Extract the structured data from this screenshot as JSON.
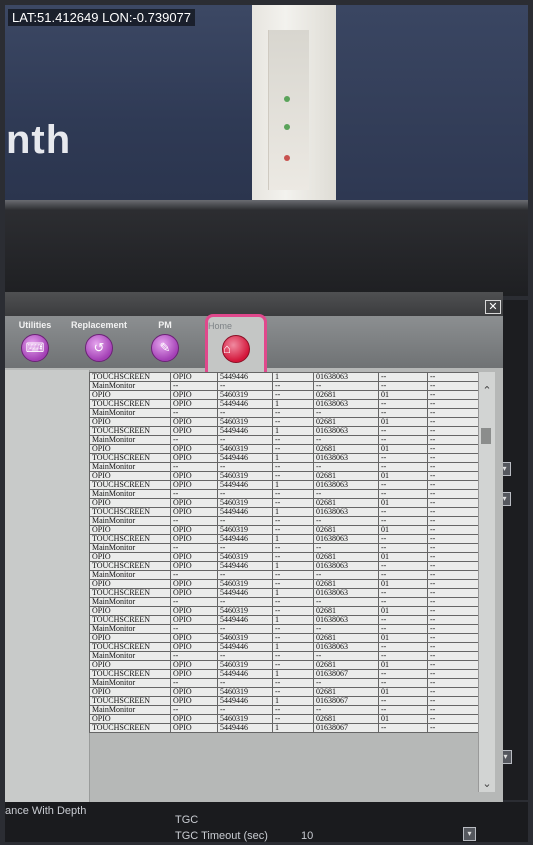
{
  "gps_overlay": "LAT:51.412649 LON:-0.739077",
  "background_text": "nth",
  "toolbar": {
    "items": [
      {
        "label": "Utilities",
        "icon": "utilities-icon"
      },
      {
        "label": "Replacement",
        "icon": "replacement-icon"
      },
      {
        "label": "PM",
        "icon": "pm-icon"
      },
      {
        "label": "Home",
        "icon": "home-icon"
      }
    ]
  },
  "close_label": "✕",
  "table": {
    "rows": [
      [
        "TOUCHSCREEN",
        "OPIO",
        "5449446",
        "1",
        "01638063",
        "--",
        "--"
      ],
      [
        "MainMonitor",
        "--",
        "--",
        "--",
        "--",
        "--",
        "--"
      ],
      [
        "OPIO",
        "OPIO",
        "5460319",
        "--",
        "02681",
        "01",
        "--"
      ],
      [
        "TOUCHSCREEN",
        "OPIO",
        "5449446",
        "1",
        "01638063",
        "--",
        "--"
      ],
      [
        "MainMonitor",
        "--",
        "--",
        "--",
        "--",
        "--",
        "--"
      ],
      [
        "OPIO",
        "OPIO",
        "5460319",
        "--",
        "02681",
        "01",
        "--"
      ],
      [
        "TOUCHSCREEN",
        "OPIO",
        "5449446",
        "1",
        "01638063",
        "--",
        "--"
      ],
      [
        "MainMonitor",
        "--",
        "--",
        "--",
        "--",
        "--",
        "--"
      ],
      [
        "OPIO",
        "OPIO",
        "5460319",
        "--",
        "02681",
        "01",
        "--"
      ],
      [
        "TOUCHSCREEN",
        "OPIO",
        "5449446",
        "1",
        "01638063",
        "--",
        "--"
      ],
      [
        "MainMonitor",
        "--",
        "--",
        "--",
        "--",
        "--",
        "--"
      ],
      [
        "OPIO",
        "OPIO",
        "5460319",
        "--",
        "02681",
        "01",
        "--"
      ],
      [
        "TOUCHSCREEN",
        "OPIO",
        "5449446",
        "1",
        "01638063",
        "--",
        "--"
      ],
      [
        "MainMonitor",
        "--",
        "--",
        "--",
        "--",
        "--",
        "--"
      ],
      [
        "OPIO",
        "OPIO",
        "5460319",
        "--",
        "02681",
        "01",
        "--"
      ],
      [
        "TOUCHSCREEN",
        "OPIO",
        "5449446",
        "1",
        "01638063",
        "--",
        "--"
      ],
      [
        "MainMonitor",
        "--",
        "--",
        "--",
        "--",
        "--",
        "--"
      ],
      [
        "OPIO",
        "OPIO",
        "5460319",
        "--",
        "02681",
        "01",
        "--"
      ],
      [
        "TOUCHSCREEN",
        "OPIO",
        "5449446",
        "1",
        "01638063",
        "--",
        "--"
      ],
      [
        "MainMonitor",
        "--",
        "--",
        "--",
        "--",
        "--",
        "--"
      ],
      [
        "OPIO",
        "OPIO",
        "5460319",
        "--",
        "02681",
        "01",
        "--"
      ],
      [
        "TOUCHSCREEN",
        "OPIO",
        "5449446",
        "1",
        "01638063",
        "--",
        "--"
      ],
      [
        "MainMonitor",
        "--",
        "--",
        "--",
        "--",
        "--",
        "--"
      ],
      [
        "OPIO",
        "OPIO",
        "5460319",
        "--",
        "02681",
        "01",
        "--"
      ],
      [
        "TOUCHSCREEN",
        "OPIO",
        "5449446",
        "1",
        "01638063",
        "--",
        "--"
      ],
      [
        "MainMonitor",
        "--",
        "--",
        "--",
        "--",
        "--",
        "--"
      ],
      [
        "OPIO",
        "OPIO",
        "5460319",
        "--",
        "02681",
        "01",
        "--"
      ],
      [
        "TOUCHSCREEN",
        "OPIO",
        "5449446",
        "1",
        "01638063",
        "--",
        "--"
      ],
      [
        "MainMonitor",
        "--",
        "--",
        "--",
        "--",
        "--",
        "--"
      ],
      [
        "OPIO",
        "OPIO",
        "5460319",
        "--",
        "02681",
        "01",
        "--"
      ],
      [
        "TOUCHSCREEN",
        "OPIO",
        "5449446",
        "1",
        "01638063",
        "--",
        "--"
      ],
      [
        "MainMonitor",
        "--",
        "--",
        "--",
        "--",
        "--",
        "--"
      ],
      [
        "OPIO",
        "OPIO",
        "5460319",
        "--",
        "02681",
        "01",
        "--"
      ],
      [
        "TOUCHSCREEN",
        "OPIO",
        "5449446",
        "1",
        "01638067",
        "--",
        "--"
      ],
      [
        "MainMonitor",
        "--",
        "--",
        "--",
        "--",
        "--",
        "--"
      ],
      [
        "OPIO",
        "OPIO",
        "5460319",
        "--",
        "02681",
        "01",
        "--"
      ],
      [
        "TOUCHSCREEN",
        "OPIO",
        "5449446",
        "1",
        "01638067",
        "--",
        "--"
      ],
      [
        "MainMonitor",
        "--",
        "--",
        "--",
        "--",
        "--",
        "--"
      ],
      [
        "OPIO",
        "OPIO",
        "5460319",
        "--",
        "02681",
        "01",
        "--"
      ],
      [
        "TOUCHSCREEN",
        "OPIO",
        "5449446",
        "1",
        "01638067",
        "--",
        "--"
      ]
    ]
  },
  "underlying": {
    "depth_label": "ance With Depth",
    "tgc_label": "TGC",
    "tgc_timeout_label": "TGC Timeout (sec)",
    "tgc_timeout_value": "10"
  }
}
